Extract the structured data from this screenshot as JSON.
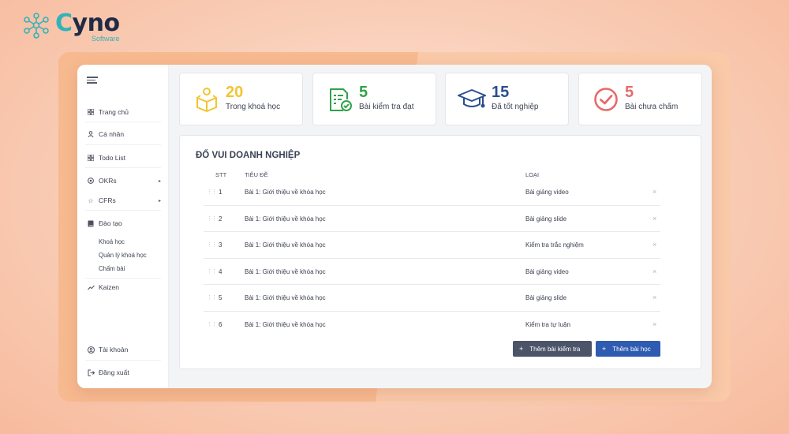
{
  "logo": {
    "name_c": "C",
    "name_rest": "yno",
    "sub": "Software"
  },
  "sidebar": {
    "items": [
      {
        "label": "Trang chủ",
        "icon": "grid-icon"
      },
      {
        "label": "Cá nhân",
        "icon": "user-icon"
      },
      {
        "label": "Todo List",
        "icon": "grid-icon"
      },
      {
        "label": "OKRs",
        "icon": "target-icon"
      },
      {
        "label": "CFRs",
        "icon": "star-icon"
      },
      {
        "label": "Đào tạo",
        "icon": "book-icon"
      },
      {
        "label": "Kaizen",
        "icon": "trend-icon"
      },
      {
        "label": "Tài khoản",
        "icon": "account-icon"
      },
      {
        "label": "Đăng xuất",
        "icon": "logout-icon"
      }
    ],
    "sub_items": [
      "Khoá học",
      "Quản lý khoá học",
      "Chấm bài"
    ]
  },
  "stats": [
    {
      "value": "20",
      "label": "Trong khoá học",
      "color": "#f2c530"
    },
    {
      "value": "5",
      "label": "Bài kiểm tra đạt",
      "color": "#2fa24a"
    },
    {
      "value": "15",
      "label": "Đã tốt nghiệp",
      "color": "#2a4f8f"
    },
    {
      "value": "5",
      "label": "Bài chưa chấm",
      "color": "#e86a6a"
    }
  ],
  "panel": {
    "title": "ĐỐ VUI DOANH NGHIỆP",
    "headers": {
      "stt": "STT",
      "title": "TIÊU ĐỀ",
      "type": "LOẠI"
    },
    "rows": [
      {
        "stt": "1",
        "title": "Bài 1: Giới thiệu về khóa học",
        "type": "Bài giảng video"
      },
      {
        "stt": "2",
        "title": "Bài 1: Giới thiệu về khóa học",
        "type": "Bài giảng slide"
      },
      {
        "stt": "3",
        "title": "Bài 1: Giới thiệu về khóa học",
        "type": "Kiểm tra trắc nghiệm"
      },
      {
        "stt": "4",
        "title": "Bài 1: Giới thiệu về khóa học",
        "type": "Bài giảng video"
      },
      {
        "stt": "5",
        "title": "Bài 1: Giới thiệu về khóa học",
        "type": "Bài giảng slide"
      },
      {
        "stt": "6",
        "title": "Bài 1: Giới thiệu về khóa học",
        "type": "Kiểm tra tự luận"
      }
    ],
    "buttons": {
      "add_test": "Thêm bài kiểm tra",
      "add_lesson": "Thêm bài học"
    }
  },
  "colors": {
    "primary_button": "#2f5bb1",
    "secondary_button": "#4b5468",
    "brand_teal": "#33b3b9"
  }
}
